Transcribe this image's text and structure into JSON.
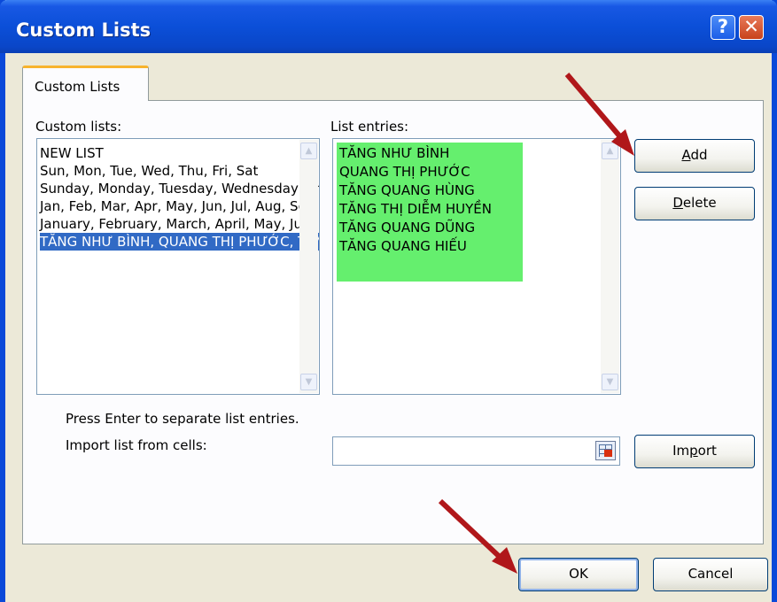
{
  "window": {
    "title": "Custom Lists"
  },
  "tabs": [
    {
      "label": "Custom Lists"
    }
  ],
  "custom_lists": {
    "label": "Custom lists:",
    "items": [
      "NEW LIST",
      "Sun, Mon, Tue, Wed, Thu, Fri, Sat",
      "Sunday, Monday, Tuesday, Wednesday, Thursday, Friday, Saturday",
      "Jan, Feb, Mar, Apr, May, Jun, Jul, Aug, Sep, Oct, Nov, Dec",
      "January, February, March, April, May, June, July, August, September, October, November, December",
      "TĂNG NHƯ BÌNH, QUANG THỊ PHƯỚC, TĂNG QUANG HÙNG, TĂNG THỊ DIỄM HUYỀN, TĂNG QUANG DŨNG, TĂNG QUANG HIẾU"
    ],
    "selected_index": 5
  },
  "list_entries": {
    "label": "List entries:",
    "items": [
      "TĂNG NHƯ BÌNH",
      "QUANG THỊ PHƯỚC",
      "TĂNG QUANG HÙNG",
      "TĂNG THỊ DIỄM HUYỀN",
      "TĂNG QUANG DŨNG",
      "TĂNG QUANG HIẾU"
    ],
    "highlight_color": "#65ef6e"
  },
  "buttons": {
    "add": "Add",
    "delete": "Delete",
    "import": "Import",
    "ok": "OK",
    "cancel": "Cancel"
  },
  "hint": "Press Enter to separate list entries.",
  "import_field": {
    "label": "Import list from cells:",
    "value": ""
  },
  "colors": {
    "title_bar": "#0b4fd8",
    "selection": "#316ac5",
    "annotation_arrow": "#b0171a"
  }
}
